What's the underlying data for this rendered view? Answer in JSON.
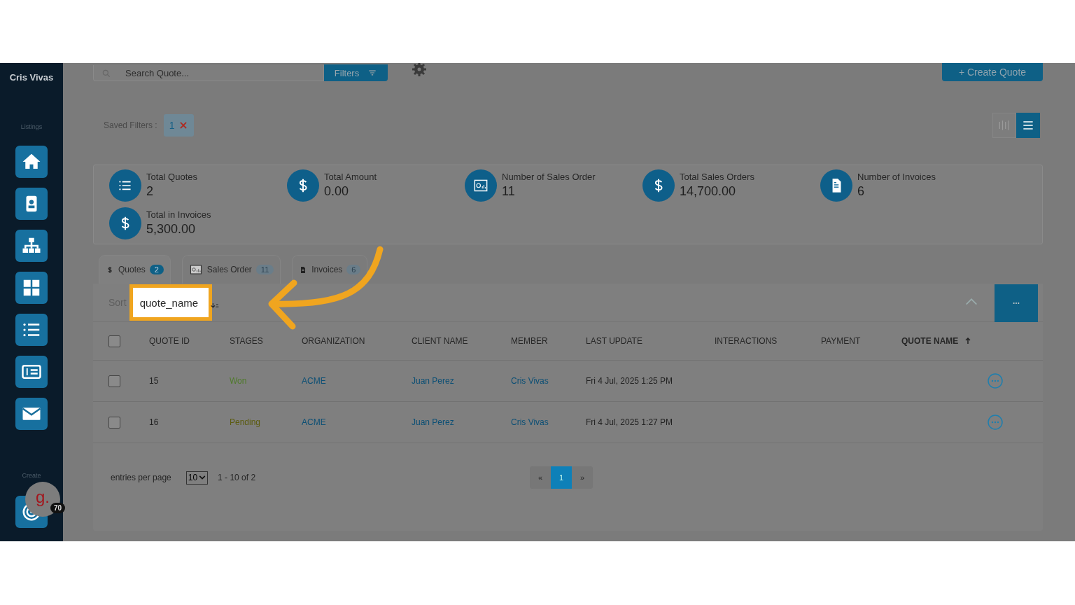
{
  "sidebar": {
    "user": "Cris Vivas",
    "listings_label": "Listings",
    "create_label": "Create"
  },
  "toolbar": {
    "search": {
      "placeholder": "Search Quote..."
    },
    "filters_label": "Filters",
    "create_label": "+ Create Quote"
  },
  "saved_filters": {
    "label": "Saved Filters :",
    "chips": [
      {
        "label": "1"
      }
    ]
  },
  "view_toggle": [
    {
      "kind": "columns",
      "selected": false
    },
    {
      "kind": "list",
      "selected": true
    }
  ],
  "stats": [
    {
      "kind": "list",
      "label": "Total Quotes",
      "value": "2"
    },
    {
      "kind": "dollar",
      "label": "Total Amount",
      "value": "0.00"
    },
    {
      "kind": "chart",
      "label": "Number of Sales Order",
      "value": "11"
    },
    {
      "kind": "dollar",
      "label": "Total Sales Orders",
      "value": "14,700.00"
    },
    {
      "kind": "doc",
      "label": "Number of Invoices",
      "value": "6"
    },
    {
      "kind": "dollar",
      "label": "Total in Invoices",
      "value": "5,300.00"
    }
  ],
  "tabs": [
    {
      "kind": "dollar",
      "label": "Quotes",
      "count": "2",
      "selected": true
    },
    {
      "kind": "chart",
      "label": "Sales Order",
      "count": "11",
      "selected": false
    },
    {
      "kind": "doc",
      "label": "Invoices",
      "count": "6",
      "selected": false
    }
  ],
  "sort": {
    "label": "Sort",
    "field": "quote_name"
  },
  "table": {
    "select_all_checked": false,
    "columns": [
      {
        "label": "QUOTE ID",
        "sorted": false
      },
      {
        "label": "STAGES",
        "sorted": false
      },
      {
        "label": "ORGANIZATION",
        "sorted": false
      },
      {
        "label": "CLIENT NAME",
        "sorted": false
      },
      {
        "label": "MEMBER",
        "sorted": false
      },
      {
        "label": "LAST UPDATE",
        "sorted": false
      },
      {
        "label": "INTERACTIONS",
        "sorted": false
      },
      {
        "label": "PAYMENT",
        "sorted": false
      },
      {
        "label": "QUOTE NAME",
        "sorted": true
      }
    ],
    "rows": [
      {
        "checked": false,
        "quote_id": "15",
        "stage": "Won",
        "color": "#4f7a2a",
        "organization": "ACME",
        "client": "Juan Perez",
        "member": "Cris Vivas",
        "last_update": "Fri 4 Jul, 2025 1:25 PM"
      },
      {
        "checked": false,
        "quote_id": "16",
        "stage": "Pending",
        "color": "#5c5c10",
        "organization": "ACME",
        "client": "Juan Perez",
        "member": "Cris Vivas",
        "last_update": "Fri 4 Jul, 2025 1:27 PM"
      }
    ]
  },
  "footer": {
    "entries_label": "entries per page",
    "per_page": "10",
    "range": "1 - 10 of 2",
    "prev": "«",
    "next": "»",
    "pages": [
      {
        "label": "1",
        "selected": true
      }
    ]
  },
  "widget": {
    "letter": "g.",
    "badge": "70"
  }
}
